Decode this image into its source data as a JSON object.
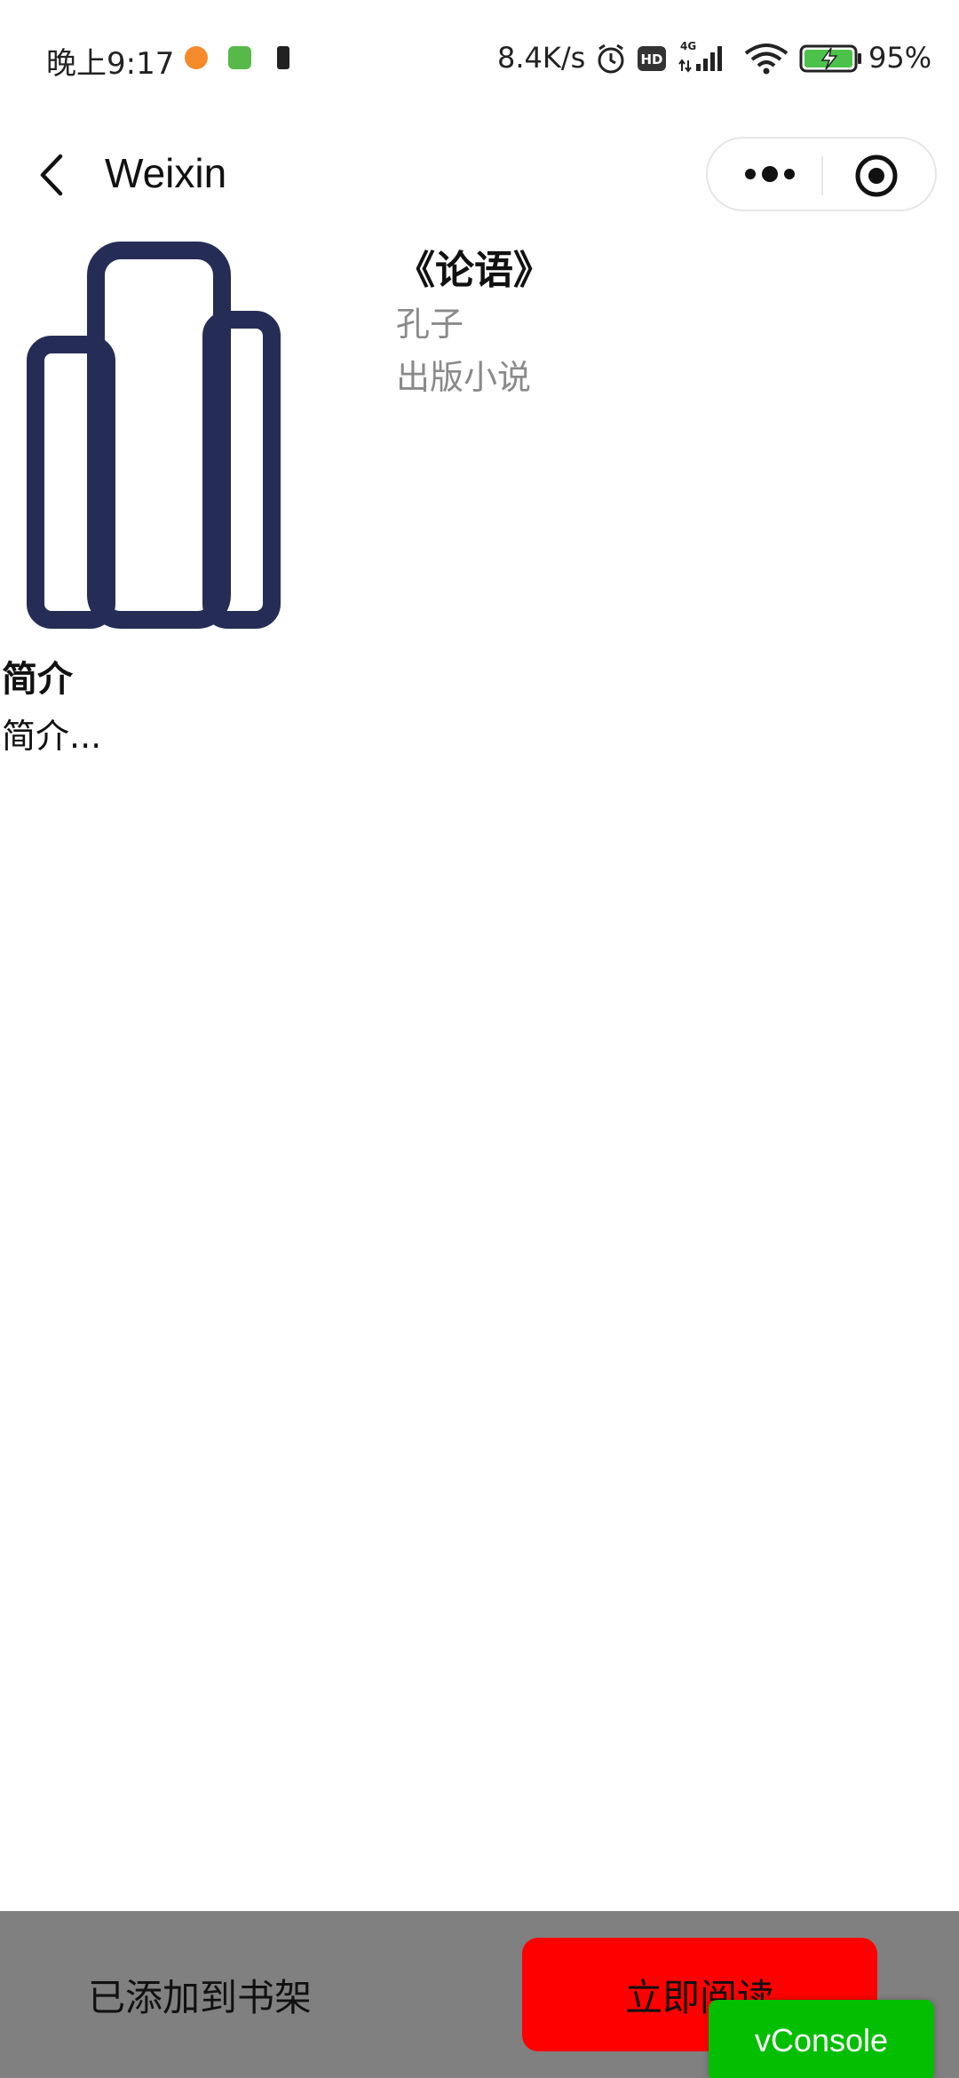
{
  "status_bar": {
    "time": "晚上9:17",
    "network_speed": "8.4K/s",
    "battery_percent": "95%",
    "icons": [
      "message-icon",
      "app-icon",
      "sim-icon",
      "alarm-icon",
      "hd-icon",
      "signal-4g-icon",
      "wifi-icon",
      "battery-charging-icon"
    ]
  },
  "nav": {
    "title": "Weixin",
    "icons": [
      "back-arrow-icon",
      "more-dots-icon",
      "close-target-icon"
    ]
  },
  "book": {
    "cover_icon": "books-icon",
    "title": "《论语》",
    "author": "孔子",
    "category": "出版小说",
    "intro_heading": "简介",
    "intro_text": "简介..."
  },
  "bottom_bar": {
    "bookshelf_label": "已添加到书架",
    "read_label": "立即阅读"
  },
  "vconsole": {
    "label": "vConsole"
  },
  "colors": {
    "bottom_bar_bg": "#808080",
    "read_button": "#ff0000",
    "vconsole": "#04be02",
    "cover_icon": "#252d57"
  }
}
